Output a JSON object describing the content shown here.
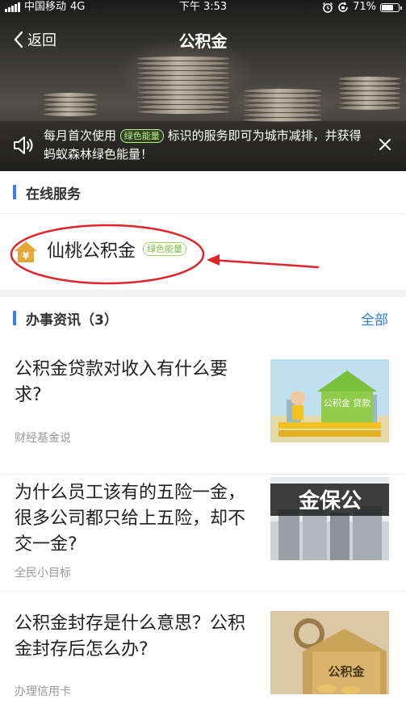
{
  "status": {
    "carrier": "中国移动",
    "network": "4G",
    "time": "下午 3:53",
    "battery": "71%",
    "battery_level": 0.71
  },
  "nav": {
    "back_label": "返回",
    "title": "公积金"
  },
  "notice": {
    "text_before": "每月首次使用",
    "badge": "绿色能量",
    "text_after": "标识的服务即可为城市减排，并获得蚂蚁森林绿色能量！"
  },
  "online_service": {
    "title": "在线服务",
    "item_name": "仙桃公积金",
    "item_badge": "绿色能量",
    "icon_glyph": "¥"
  },
  "news": {
    "title": "办事资讯（3）",
    "more_label": "全部",
    "items": [
      {
        "title": "公积金贷款对收入有什么要求?",
        "source": "财经基金说",
        "thumb_text": "公积金 贷款"
      },
      {
        "title": "为什么员工该有的五险一金，很多公司都只给上五险，却不交一金?",
        "source": "全民小目标",
        "thumb_text": "金保公"
      },
      {
        "title": "公积金封存是什么意思？公积金封存后怎么办?",
        "source": "办理信用卡",
        "thumb_text": "公积金"
      }
    ]
  },
  "colors": {
    "accent_blue": "#3b7de9",
    "annotation_red": "#e0252b",
    "green_badge": "#7ec147"
  }
}
